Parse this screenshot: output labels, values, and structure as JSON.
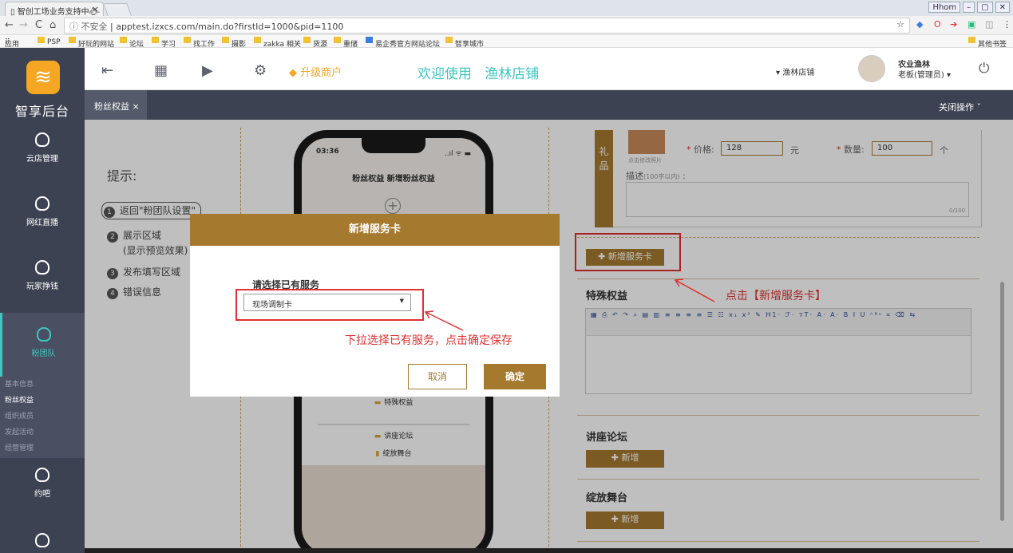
{
  "browser": {
    "tab_title": "智创工场业务支持中心-",
    "tab_close": "×",
    "window_label": "Hhom",
    "nav": {
      "back": "←",
      "forward": "→",
      "reload": "C",
      "home": "⌂"
    },
    "security": "ⓘ 不安全",
    "url": "apptest.izxcs.com/main.do?firstId=1000&pid=1100",
    "bookmarks": [
      "应用",
      "PSP",
      "好玩的网站",
      "论坛",
      "学习",
      "找工作",
      "摄影",
      "zakka 相关",
      "货源",
      "重储",
      "易企秀官方网站论坛",
      "智享城市"
    ],
    "other_bookmarks": "其他书签"
  },
  "header": {
    "logo_text": "智享后台",
    "upgrade": "升级商户",
    "welcome": "欢迎使用",
    "shop_name": "渔林店铺",
    "store_select": "▾ 渔林店铺",
    "user_name": "农业渔林",
    "user_role": "老板(管理员) ▾"
  },
  "tabs": {
    "current": "粉丝权益 ×",
    "close_ops": "关闭操作 ˇ"
  },
  "sidebar": {
    "items": [
      "云店管理",
      "网红直播",
      "玩家挣钱",
      "粉团队",
      "约吧"
    ],
    "sub_items": [
      "基本信息",
      "粉丝权益",
      "组织成员",
      "发起活动",
      "经营管理"
    ]
  },
  "tips": {
    "title": "提示:",
    "items": [
      {
        "n": "1",
        "text": "返回\"粉团队设置\""
      },
      {
        "n": "2",
        "text": "展示区域"
      },
      {
        "n": "",
        "text": "(显示预览效果)"
      },
      {
        "n": "3",
        "text": "发布填写区域"
      },
      {
        "n": "4",
        "text": "错误信息"
      }
    ]
  },
  "phone": {
    "time": "03:36",
    "signal": "..ıl ᯤ ▬",
    "title": "粉丝权益 新增粉丝权益",
    "list": [
      "特殊权益",
      "讲座论坛",
      "绽放舞台"
    ]
  },
  "form": {
    "gift_label": "礼\n品",
    "img_hint": "点击修改照片",
    "price_label": "价格:",
    "price_value": "128",
    "price_unit": "元",
    "qty_label": "数量:",
    "qty_value": "100",
    "qty_unit": "个",
    "desc_label": "描述",
    "desc_hint": "(100字以内)",
    "desc_colon": ":",
    "desc_count": "0/100",
    "add_service_btn": "✚ 新增服务卡",
    "special_title": "特殊权益",
    "editor_toolbar": "▦ ⎙ ↶ ↷ ⌕ ▤ ▥ ≡ ≡ ≡ ≡ ☰ ☷ x₁ x² ✎ H1· ℱ· ᴛT· A· A· B I U ᴬᴮᶜ ⌗ ⌫ ⇆",
    "forum_title": "讲座论坛",
    "add_btn": "✚ 新增",
    "stage_title": "绽放舞台"
  },
  "annotations": {
    "click_add": "点击【新增服务卡】",
    "dropdown_hint": "下拉选择已有服务，点击确定保存"
  },
  "modal": {
    "title": "新增服务卡",
    "select_label": "请选择已有服务",
    "select_value": "现场调制卡",
    "cancel": "取消",
    "confirm": "确定"
  },
  "colors": {
    "gold": "#a57a2f",
    "teal": "#3ec6c1",
    "dark": "#3d4252",
    "red": "#e03030"
  }
}
